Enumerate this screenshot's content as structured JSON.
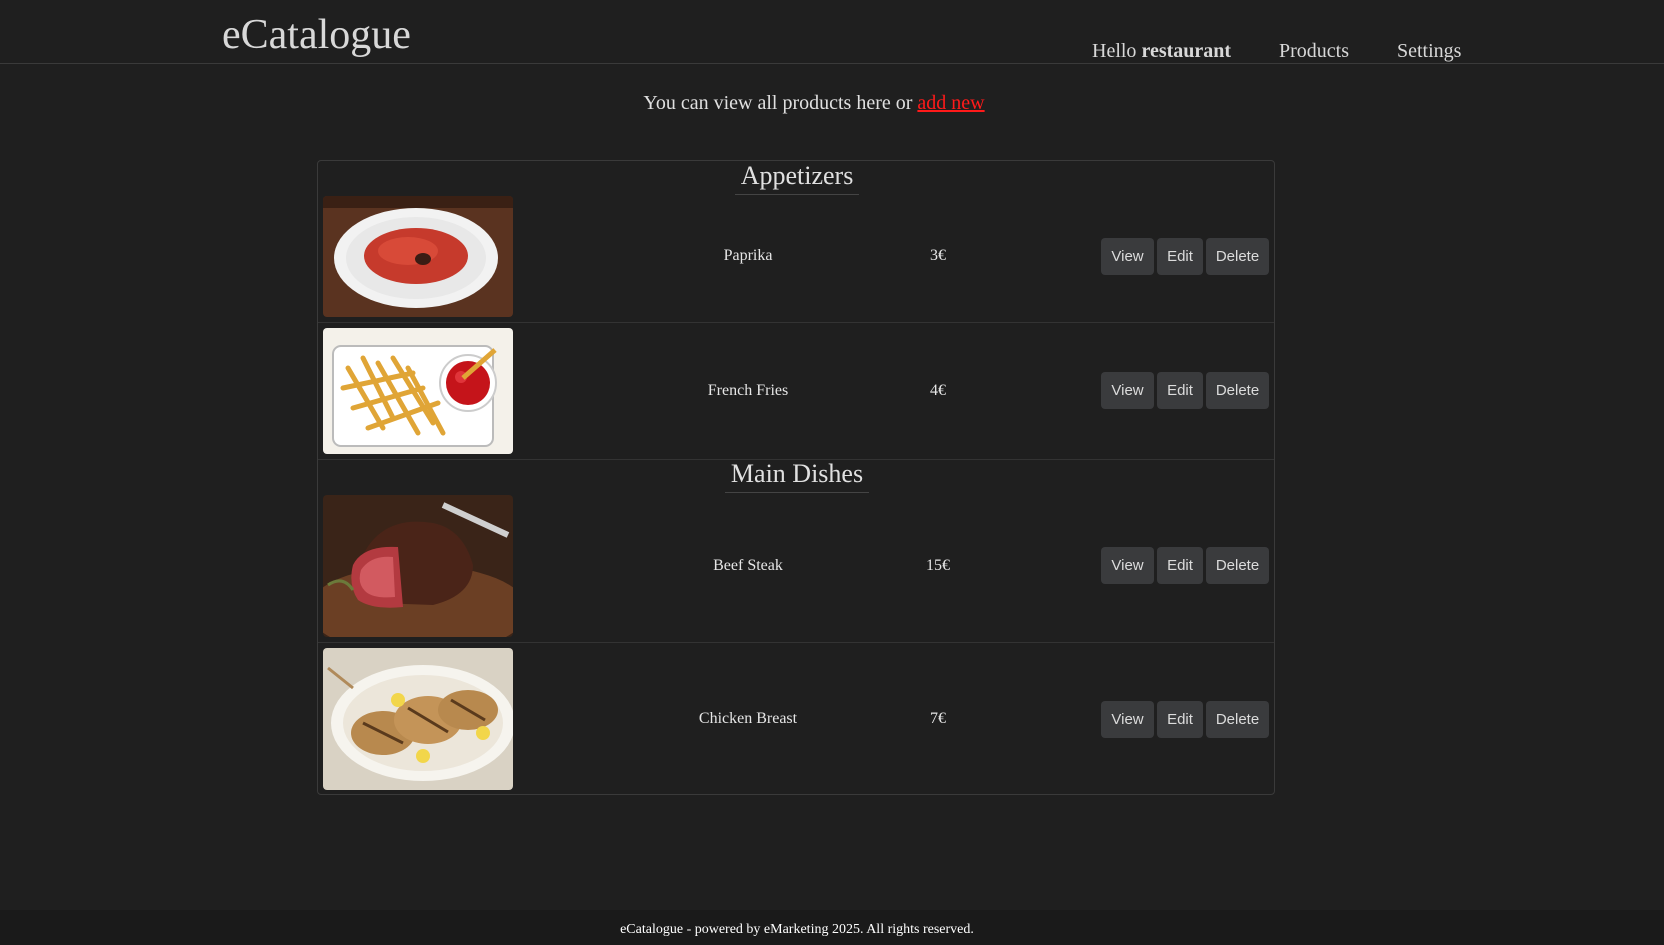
{
  "header": {
    "brand": "eCatalogue",
    "greeting": "Hello",
    "username": "restaurant",
    "nav_products": "Products",
    "nav_settings": "Settings"
  },
  "intro": {
    "text": "You can view all products here or",
    "link": "add new"
  },
  "categories": [
    {
      "name": "Appetizers",
      "products": [
        {
          "name": "Paprika",
          "price": "3€",
          "image": "paprika-dip"
        },
        {
          "name": "French Fries",
          "price": "4€",
          "image": "french-fries"
        }
      ]
    },
    {
      "name": "Main Dishes",
      "products": [
        {
          "name": "Beef Steak",
          "price": "15€",
          "image": "beef-steak"
        },
        {
          "name": "Chicken Breast",
          "price": "7€",
          "image": "chicken-breast"
        }
      ]
    }
  ],
  "actions": {
    "view": "View",
    "edit": "Edit",
    "delete": "Delete"
  },
  "footer": {
    "text": "eCatalogue - powered by eMarketing 2025. All rights reserved."
  },
  "colors": {
    "background": "#1f1f1f",
    "link": "#ff1a1a",
    "button": "#3a3b3d"
  }
}
